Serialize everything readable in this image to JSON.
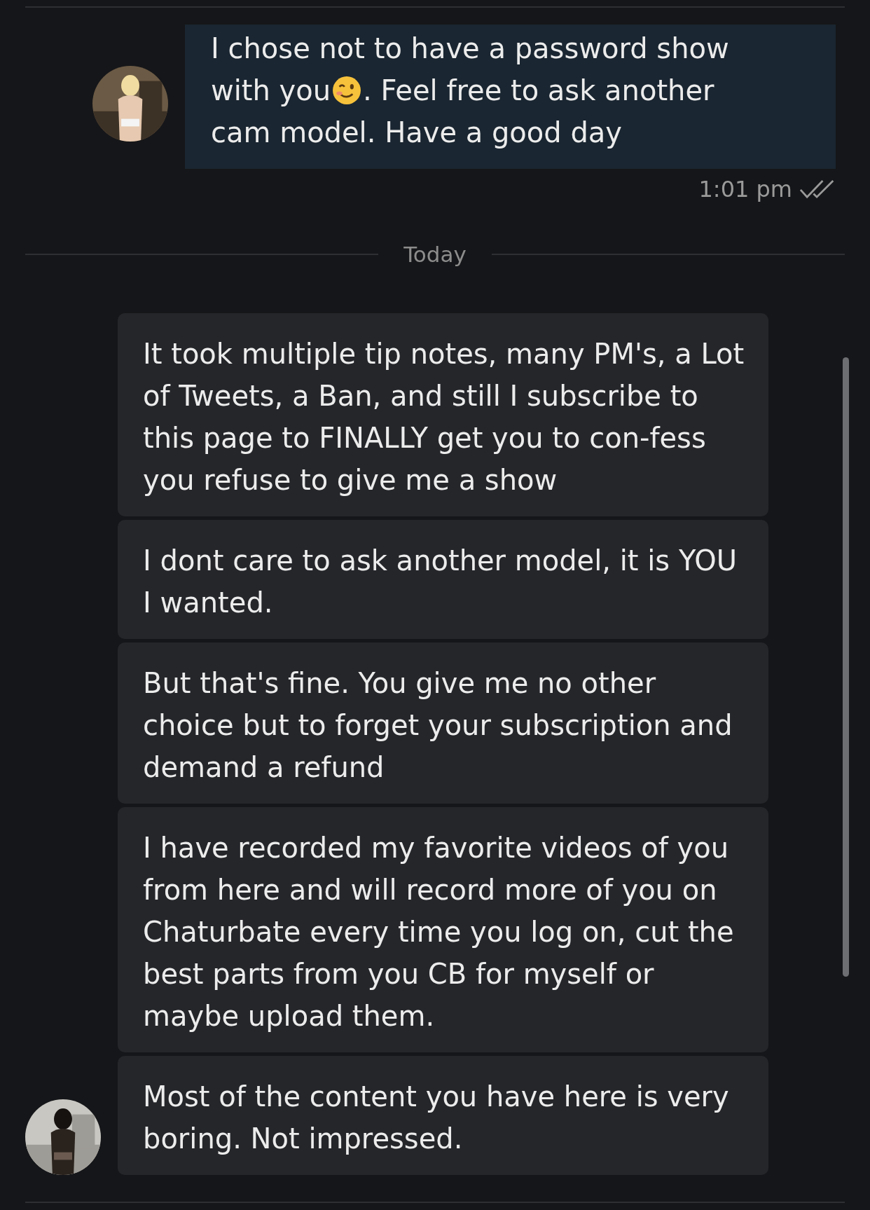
{
  "messages": [
    {
      "kind": "sent",
      "lines": [
        [
          {
            "kind": "text",
            "text": "I chose not to have a password show"
          }
        ],
        [
          {
            "kind": "text",
            "text": "with you"
          },
          {
            "kind": "emoji"
          },
          {
            "kind": "text",
            "text": ". Feel free to ask another"
          }
        ],
        [
          {
            "kind": "text",
            "text": "cam model. Have a good day"
          }
        ]
      ],
      "time": "1:01 pm",
      "read": true
    },
    {
      "kind": "divider",
      "label": "Today"
    },
    {
      "kind": "received",
      "bubbles": [
        {
          "text": "It took multiple tip notes, many PM's, a Lot of Tweets, a Ban, and still I subscribe to this page to FINALLY get you to con-fess you refuse to give me a show"
        },
        {
          "text": "I dont care to ask another model, it is YOU I wanted."
        },
        {
          "text": "But that's fine. You give me no other choice but to forget your subscription and demand a refund"
        },
        {
          "text": "I have recorded my favorite videos of you from here and will record more of you on Chaturbate every time you log on, cut the best parts from you CB for myself or maybe upload them."
        },
        {
          "text": "Most of the content you have here is very boring. Not impressed."
        }
      ]
    }
  ]
}
